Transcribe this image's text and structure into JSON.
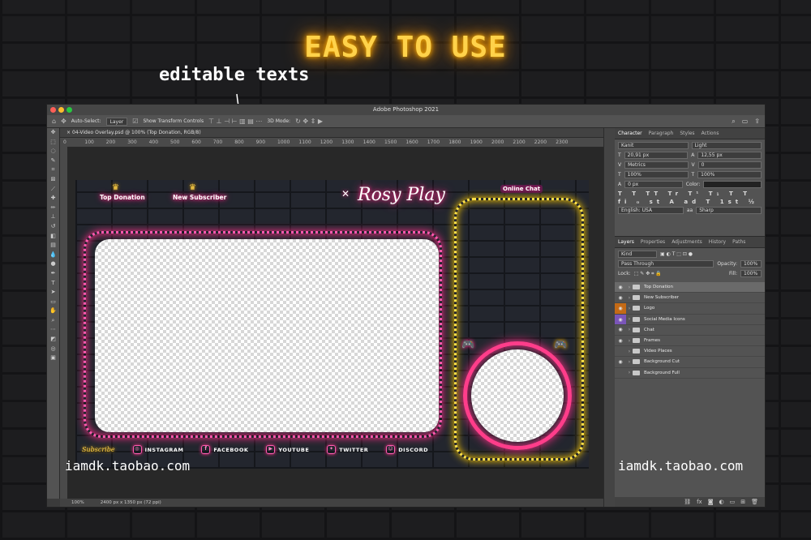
{
  "headline": "EASY TO USE",
  "annotation": "editable texts",
  "watermark": "iamdk.taobao.com",
  "app": {
    "title": "Adobe Photoshop 2021",
    "options": {
      "auto_select": "Auto-Select:",
      "auto_select_value": "Layer",
      "show_transform": "Show Transform Controls",
      "mode_3d": "3D Mode:"
    },
    "doc_tab": "04-Video Overlay.psd @ 100% (Top Donation, RGB/8)",
    "ruler_ticks": [
      "0",
      "100",
      "200",
      "300",
      "400",
      "500",
      "600",
      "700",
      "800",
      "900",
      "1000",
      "1100",
      "1200",
      "1300",
      "1400",
      "1500",
      "1600",
      "1700",
      "1800",
      "1900",
      "2000",
      "2100",
      "2200",
      "2300"
    ],
    "status": {
      "zoom": "100%",
      "doc_size": "2400 px x 1350 px (72 ppi)"
    }
  },
  "canvas": {
    "top_donation": "Top Donation",
    "new_subscriber": "New Subscriber",
    "logo": "Rosy Play",
    "online_chat": "Online Chat",
    "subscribe": "Subscribe",
    "socials": [
      {
        "label": "INSTAGRAM",
        "icon": "instagram-icon"
      },
      {
        "label": "FACEBOOK",
        "icon": "facebook-icon"
      },
      {
        "label": "YOUTUBE",
        "icon": "youtube-icon"
      },
      {
        "label": "TWITTER",
        "icon": "twitter-icon"
      },
      {
        "label": "DISCORD",
        "icon": "discord-icon"
      }
    ],
    "colors": {
      "pink": "#ff2e88",
      "yellow": "#ffcc00"
    }
  },
  "character_panel": {
    "tabs": [
      "Character",
      "Paragraph",
      "Styles",
      "Actions"
    ],
    "font_family": "Kanit",
    "font_style": "Light",
    "size": "20,91 px",
    "leading": "12,55 px",
    "kerning": "Metrics",
    "tracking": "0",
    "vscale": "100%",
    "hscale": "100%",
    "baseline": "0 px",
    "color_label": "Color:",
    "type_buttons": "T T TT Tr T¹ T₁ T T",
    "language": "English: USA",
    "aa": "Sharp"
  },
  "layers_panel": {
    "tabs": [
      "Layers",
      "Properties",
      "Adjustments",
      "History",
      "Paths"
    ],
    "filter": "Kind",
    "blend": "Pass Through",
    "opacity_label": "Opacity:",
    "opacity": "100%",
    "lock_label": "Lock:",
    "fill_label": "Fill:",
    "fill": "100%",
    "layers": [
      {
        "name": "Top Donation",
        "visible": true,
        "selected": true
      },
      {
        "name": "New Subscriber",
        "visible": true,
        "selected": false
      },
      {
        "name": "Logo",
        "visible": true,
        "selected": false,
        "tag": "orange"
      },
      {
        "name": "Social Media Icons",
        "visible": true,
        "selected": false,
        "tag": "purple"
      },
      {
        "name": "Chat",
        "visible": true,
        "selected": false
      },
      {
        "name": "Frames",
        "visible": true,
        "selected": false
      },
      {
        "name": "Video Places",
        "visible": false,
        "selected": false
      },
      {
        "name": "Background Cut",
        "visible": true,
        "selected": false
      },
      {
        "name": "Background Full",
        "visible": false,
        "selected": false
      }
    ]
  }
}
